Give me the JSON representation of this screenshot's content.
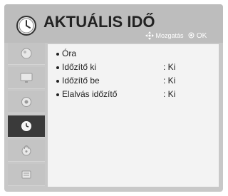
{
  "header": {
    "title": "AKTUÁLIS IDŐ",
    "hint_move": "Mozgatás",
    "hint_ok": "OK",
    "title_icon": "clock-icon"
  },
  "sidebar": {
    "items": [
      {
        "icon": "picture-icon"
      },
      {
        "icon": "screen-icon"
      },
      {
        "icon": "speaker-icon"
      },
      {
        "icon": "clock-icon",
        "selected": true
      },
      {
        "icon": "lock-icon"
      },
      {
        "icon": "options-icon"
      }
    ]
  },
  "menu": {
    "items": [
      {
        "label": "Óra",
        "value": ""
      },
      {
        "label": "Időzítő ki",
        "value": ": Ki"
      },
      {
        "label": "Időzítő be",
        "value": ": Ki"
      },
      {
        "label": "Elalvás időzítő",
        "value": ": Ki"
      }
    ]
  },
  "colors": {
    "panel": "#c8c8c8",
    "header": "#bdbdbd",
    "content": "#f3f3f3",
    "selected": "#3a3a3a"
  }
}
